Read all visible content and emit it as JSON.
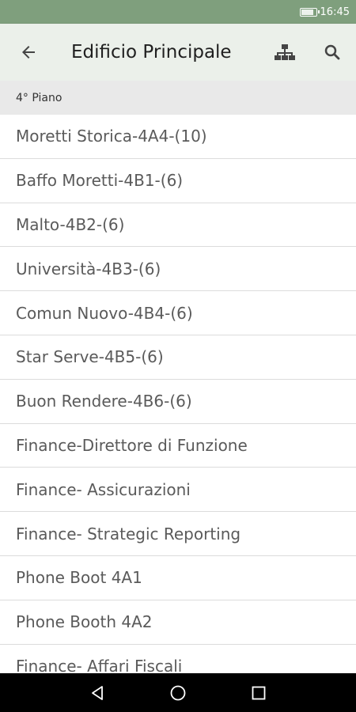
{
  "status_bar": {
    "time": "16:45"
  },
  "app_bar": {
    "title": "Edificio Principale"
  },
  "section": {
    "header": "4° Piano"
  },
  "rooms": [
    "Moretti Storica-4A4-(10)",
    "Baffo Moretti-4B1-(6)",
    "Malto-4B2-(6)",
    "Università-4B3-(6)",
    "Comun Nuovo-4B4-(6)",
    "Star Serve-4B5-(6)",
    "Buon Rendere-4B6-(6)",
    "Finance-Direttore di Funzione",
    "Finance- Assicurazioni",
    "Finance- Strategic Reporting",
    "Phone Boot 4A1",
    "Phone Booth 4A2",
    "Finance- Affari Fiscali"
  ],
  "colors": {
    "status_bar": "#7f9f7d",
    "app_bar": "#ebf0ea",
    "section_header": "#e9e9e9",
    "nav_bar": "#000000"
  },
  "icons": {
    "back": "arrow-back-icon",
    "tree": "sitemap-icon",
    "search": "search-icon",
    "nav_back": "triangle-back-icon",
    "nav_home": "circle-home-icon",
    "nav_recents": "square-recents-icon",
    "battery": "battery-icon"
  }
}
